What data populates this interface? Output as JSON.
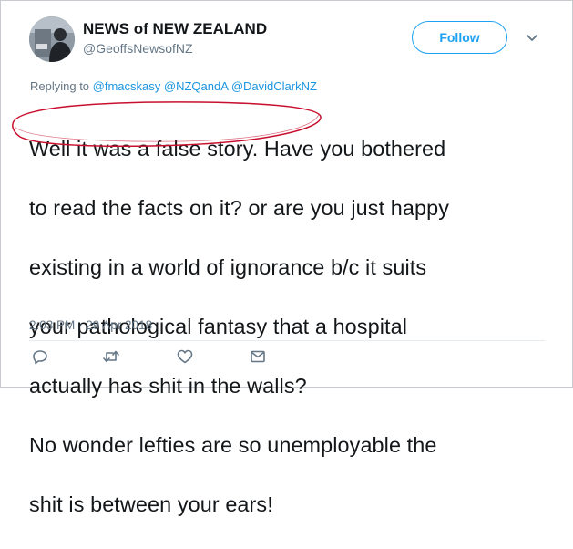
{
  "tweet": {
    "display_name": "NEWS of NEW ZEALAND",
    "handle": "@GeoffsNewsofNZ",
    "follow_label": "Follow",
    "reply_prefix": "Replying to",
    "mentions": [
      "@fmacskasy",
      "@NZQandA",
      "@DavidClarkNZ"
    ],
    "text_lines": [
      "Well it was a false story. Have you bothered",
      "to read the facts on it? or are you just happy",
      "existing in a world of ignorance b/c it suits",
      "your pathological fantasy that a hospital",
      "actually has shit in the walls?",
      "No wonder lefties are so unemployable the",
      "shit is between your ears!"
    ],
    "timestamp": "2:03 PM - 29 Apr 2018"
  },
  "icons": {
    "more": "chevron-down-icon",
    "reply": "reply-icon",
    "retweet": "retweet-icon",
    "like": "heart-icon",
    "message": "envelope-icon"
  },
  "colors": {
    "accent": "#1da1f2",
    "mention": "#1b95e0",
    "secondary_text": "#657786",
    "annotation": "#c8102e"
  }
}
